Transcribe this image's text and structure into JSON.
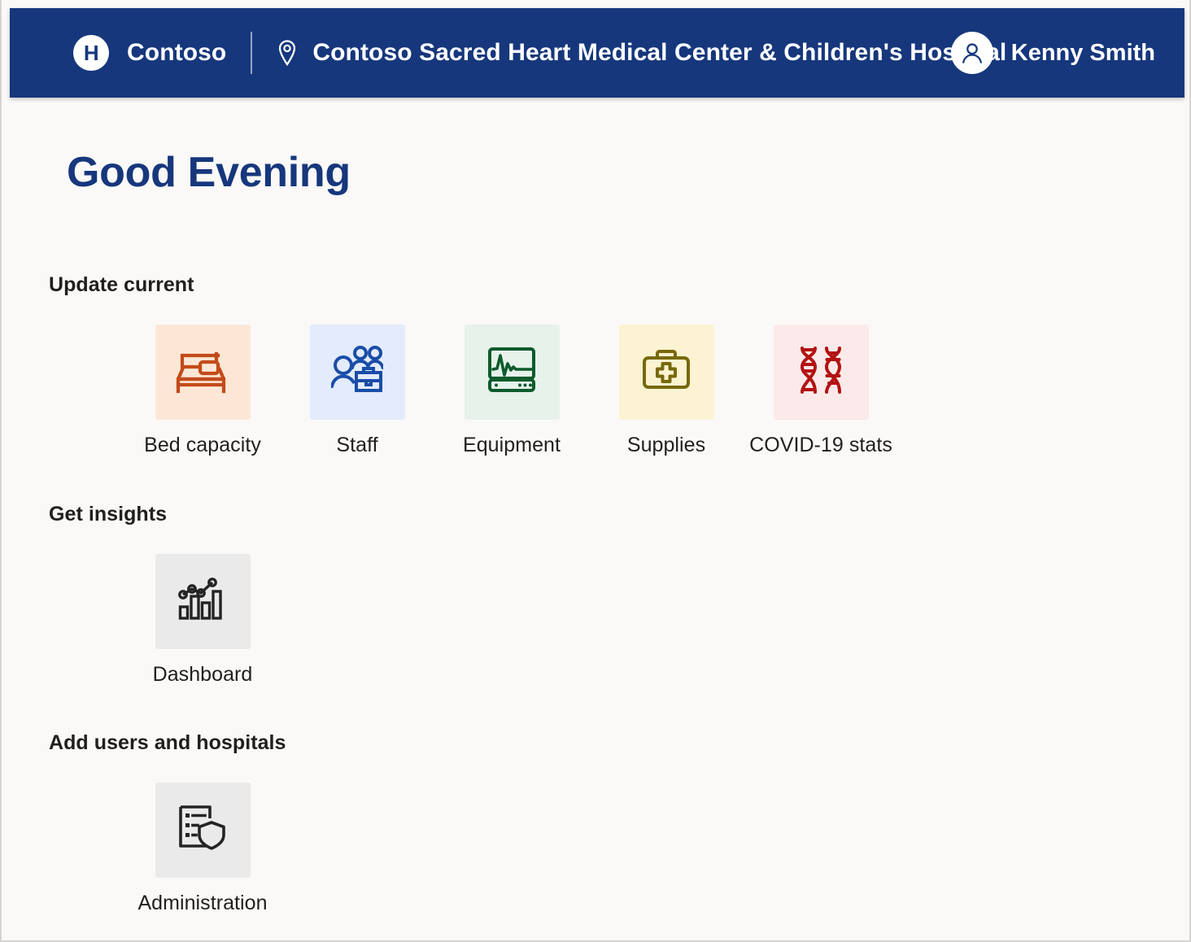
{
  "header": {
    "logo_letter": "H",
    "brand_name": "Contoso",
    "location_icon": "location-pin-icon",
    "site_name": "Contoso Sacred Heart Medical Center & Children's Hospital",
    "user_name": "Kenny Smith",
    "user_icon": "person-avatar-icon",
    "background_color": "#16377c"
  },
  "page": {
    "greeting": "Good Evening",
    "greeting_color": "#16377c",
    "background_color": "#faf9f8"
  },
  "sections": [
    {
      "title": "Update current",
      "tiles": [
        {
          "label": "Bed capacity",
          "icon": "bed-icon",
          "icon_color": "#c34b1a",
          "tile_color": "#fce7d7"
        },
        {
          "label": "Staff",
          "icon": "people-briefcase-icon",
          "icon_color": "#1a4da8",
          "tile_color": "#e3ebfc"
        },
        {
          "label": "Equipment",
          "icon": "vitals-monitor-icon",
          "icon_color": "#0d5b2c",
          "tile_color": "#e6f2ea"
        },
        {
          "label": "Supplies",
          "icon": "first-aid-kit-icon",
          "icon_color": "#77690a",
          "tile_color": "#fbf3d1"
        },
        {
          "label": "COVID-19 stats",
          "icon": "dna-helix-icon",
          "icon_color": "#b31212",
          "tile_color": "#fbeae9"
        }
      ]
    },
    {
      "title": "Get insights",
      "tiles": [
        {
          "label": "Dashboard",
          "icon": "bar-chart-trend-icon",
          "icon_color": "#242424",
          "tile_color": "#eaeaea"
        }
      ]
    },
    {
      "title": "Add users and hospitals",
      "tiles": [
        {
          "label": "Administration",
          "icon": "document-shield-icon",
          "icon_color": "#242424",
          "tile_color": "#eaeaea"
        }
      ]
    }
  ]
}
